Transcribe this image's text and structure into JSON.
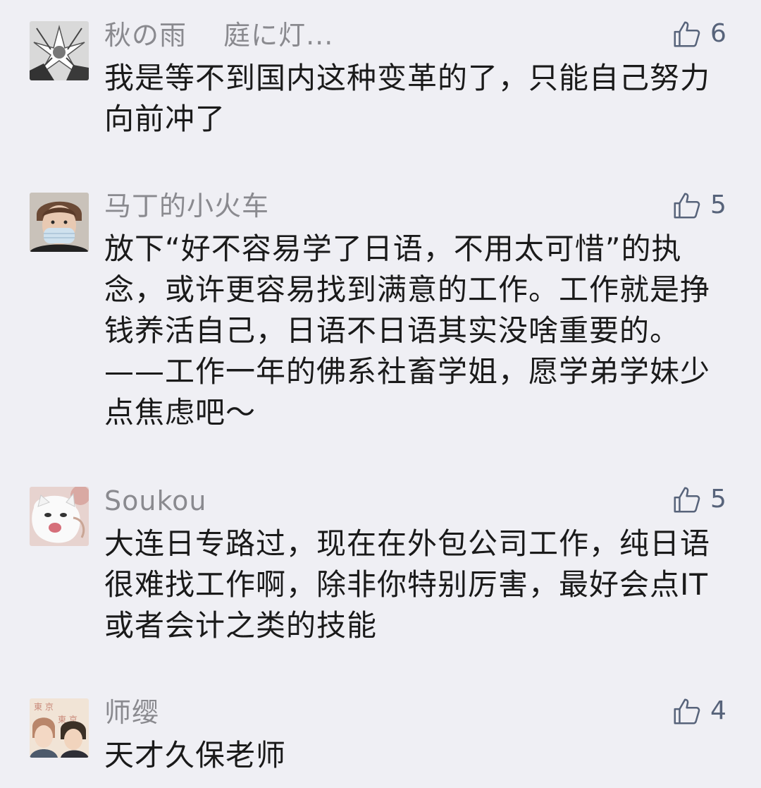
{
  "comments": [
    {
      "username": "秋の雨　 庭に灯...",
      "likes": "6",
      "text": "我是等不到国内这种变革的了，只能自己努力\n向前冲了"
    },
    {
      "username": "马丁的小火车",
      "likes": "5",
      "text": "放下“好不容易学了日语，不用太可惜”的执\n念，或许更容易找到满意的工作。工作就是挣\n钱养活自己，日语不日语其实没啥重要的。\n——工作一年的佛系社畜学姐，愿学弟学妹少\n点焦虑吧～"
    },
    {
      "username": "Soukou",
      "likes": "5",
      "text": "大连日专路过，现在在外包公司工作，纯日语\n很难找工作啊，除非你特别厉害，最好会点IT\n或者会计之类的技能"
    },
    {
      "username": "师缨",
      "likes": "4",
      "text": "天才久保老师"
    }
  ],
  "icons": {
    "like": "thumbs-up-icon"
  },
  "colors": {
    "background": "#efeff4",
    "username": "#8a8a8f",
    "text": "#1a1a1a",
    "like": "#57637a"
  }
}
